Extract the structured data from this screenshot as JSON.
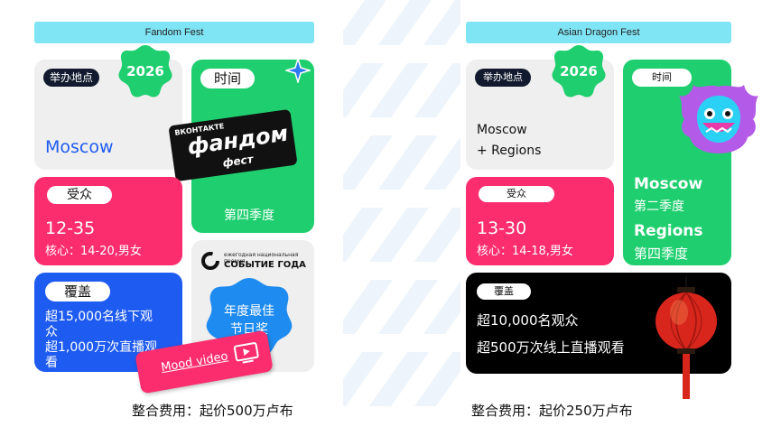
{
  "left": {
    "header": "Fandom Fest",
    "badge": "2026",
    "venue_label": "举办地点",
    "venue_value": "Moscow",
    "time_label": "时间",
    "time_value": "第四季度",
    "logo_text_top": "ВКОНТАКТЕ",
    "logo_text_main": "фандом",
    "logo_text_bottom": "фест",
    "audience_label": "受众",
    "audience_range": "12-35",
    "audience_core": "核心：14-20,男女",
    "award_logo_small": "ежегодная национальная премия",
    "award_logo_main": "СОБЫТИЕ ГОДА",
    "award_text_line1": "年度最佳",
    "award_text_line2": "节日奖",
    "coverage_label": "覆盖",
    "coverage_line1": "超15,000名线下观",
    "coverage_line2": "众",
    "coverage_line3": "超1,000万次直播观",
    "coverage_line4": "看",
    "mood_video": "Mood video",
    "fee": "整合费用：起价500万卢布"
  },
  "right": {
    "header": "Asian Dragon Fest",
    "badge": "2026",
    "venue_label": "举办地点",
    "venue_line1": "Moscow",
    "venue_line2": "+ Regions",
    "time_label": "时间",
    "time_city1": "Moscow",
    "time_season1": "第二季度",
    "time_city2": "Regions",
    "time_season2": "第四季度",
    "audience_label": "受众",
    "audience_range": "13-30",
    "audience_core": "核心：14-18,男女",
    "coverage_label": "覆盖",
    "coverage_line1": "超10,000名观众",
    "coverage_line2": "超500万次线上直播观看",
    "fee": "整合费用：起价250万卢布"
  },
  "colors": {
    "header": "#7fe4f4",
    "green": "#1fcf6f",
    "pink": "#fb2d6e",
    "blue": "#1e5bf0",
    "badge": "#1fcf6f",
    "venue_text": "#1e5bf0",
    "award_badge": "#1e8bf0"
  },
  "icons": [
    "sparkle-icon",
    "play-video-icon",
    "dragon-icon",
    "lantern-icon",
    "award-ring-icon"
  ]
}
